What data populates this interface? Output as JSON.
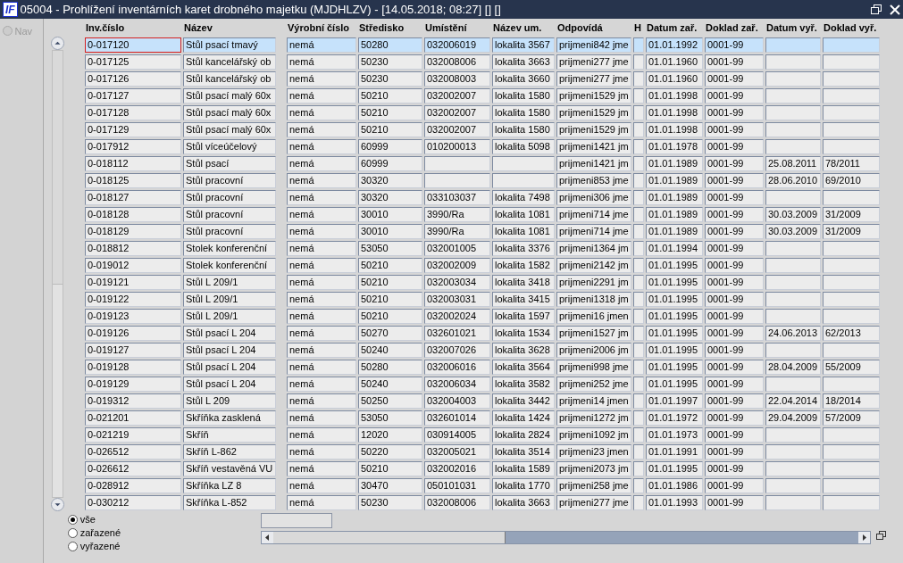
{
  "window": {
    "logo": "IF",
    "title": "05004 - Prohlížení inventárních karet drobného majetku (MJDHLZV) - [14.05.2018; 08:27]  []  []"
  },
  "nav": {
    "label": "Nav",
    "selected": false,
    "disabled": true
  },
  "table": {
    "columns": [
      "Inv.číslo",
      "Název",
      "Výrobní číslo",
      "Středisko",
      "Umístění",
      "Název um.",
      "Odpovídá",
      "H",
      "Datum zař.",
      "Doklad zař.",
      "Datum vyř.",
      "Doklad vyř."
    ],
    "rows": [
      {
        "selected": true,
        "cells": [
          "0-017120",
          "Stůl psací tmavý",
          "nemá",
          "50280",
          "032006019",
          "lokalita 3567",
          "prijmeni842 jme",
          null,
          "01.01.1992",
          "0001-99",
          null,
          null
        ]
      },
      {
        "selected": false,
        "cells": [
          "0-017125",
          "Stůl kancelářský ob",
          "nemá",
          "50230",
          "032008006",
          "lokalita 3663",
          "prijmeni277 jme",
          null,
          "01.01.1960",
          "0001-99",
          null,
          null
        ]
      },
      {
        "selected": false,
        "cells": [
          "0-017126",
          "Stůl kancelářský ob",
          "nemá",
          "50230",
          "032008003",
          "lokalita 3660",
          "prijmeni277 jme",
          null,
          "01.01.1960",
          "0001-99",
          null,
          null
        ]
      },
      {
        "selected": false,
        "cells": [
          "0-017127",
          "Stůl psací malý 60x",
          "nemá",
          "50210",
          "032002007",
          "lokalita 1580",
          "prijmeni1529 jm",
          null,
          "01.01.1998",
          "0001-99",
          null,
          null
        ]
      },
      {
        "selected": false,
        "cells": [
          "0-017128",
          "Stůl psací malý 60x",
          "nemá",
          "50210",
          "032002007",
          "lokalita 1580",
          "prijmeni1529 jm",
          null,
          "01.01.1998",
          "0001-99",
          null,
          null
        ]
      },
      {
        "selected": false,
        "cells": [
          "0-017129",
          "Stůl psací malý 60x",
          "nemá",
          "50210",
          "032002007",
          "lokalita 1580",
          "prijmeni1529 jm",
          null,
          "01.01.1998",
          "0001-99",
          null,
          null
        ]
      },
      {
        "selected": false,
        "cells": [
          "0-017912",
          "Stůl víceúčelový",
          "nemá",
          "60999",
          "010200013",
          "lokalita 5098",
          "prijmeni1421 jm",
          null,
          "01.01.1978",
          "0001-99",
          null,
          null
        ]
      },
      {
        "selected": false,
        "cells": [
          "0-018112",
          "Stůl psací",
          "nemá",
          "60999",
          null,
          null,
          "prijmeni1421 jm",
          null,
          "01.01.1989",
          "0001-99",
          "25.08.2011",
          "78/2011"
        ]
      },
      {
        "selected": false,
        "cells": [
          "0-018125",
          "Stůl pracovní",
          "nemá",
          "30320",
          null,
          null,
          "prijmeni853 jme",
          null,
          "01.01.1989",
          "0001-99",
          "28.06.2010",
          "69/2010"
        ]
      },
      {
        "selected": false,
        "cells": [
          "0-018127",
          "Stůl pracovní",
          "nemá",
          "30320",
          "033103037",
          "lokalita 7498",
          "prijmeni306 jme",
          null,
          "01.01.1989",
          "0001-99",
          null,
          null
        ]
      },
      {
        "selected": false,
        "cells": [
          "0-018128",
          "Stůl pracovní",
          "nemá",
          "30010",
          "3990/Ra",
          "lokalita 1081",
          "prijmeni714 jme",
          null,
          "01.01.1989",
          "0001-99",
          "30.03.2009",
          "31/2009"
        ]
      },
      {
        "selected": false,
        "cells": [
          "0-018129",
          "Stůl pracovní",
          "nemá",
          "30010",
          "3990/Ra",
          "lokalita 1081",
          "prijmeni714 jme",
          null,
          "01.01.1989",
          "0001-99",
          "30.03.2009",
          "31/2009"
        ]
      },
      {
        "selected": false,
        "cells": [
          "0-018812",
          "Stolek konferenční",
          "nemá",
          "53050",
          "032001005",
          "lokalita 3376",
          "prijmeni1364 jm",
          null,
          "01.01.1994",
          "0001-99",
          null,
          null
        ]
      },
      {
        "selected": false,
        "cells": [
          "0-019012",
          "Stolek konferenční",
          "nemá",
          "50210",
          "032002009",
          "lokalita 1582",
          "prijmeni2142 jm",
          null,
          "01.01.1995",
          "0001-99",
          null,
          null
        ]
      },
      {
        "selected": false,
        "cells": [
          "0-019121",
          "Stůl L 209/1",
          "nemá",
          "50210",
          "032003034",
          "lokalita 3418",
          "prijmeni2291 jm",
          null,
          "01.01.1995",
          "0001-99",
          null,
          null
        ]
      },
      {
        "selected": false,
        "cells": [
          "0-019122",
          "Stůl L 209/1",
          "nemá",
          "50210",
          "032003031",
          "lokalita 3415",
          "prijmeni1318 jm",
          null,
          "01.01.1995",
          "0001-99",
          null,
          null
        ]
      },
      {
        "selected": false,
        "cells": [
          "0-019123",
          "Stůl L 209/1",
          "nemá",
          "50210",
          "032002024",
          "lokalita 1597",
          "prijmeni16 jmen",
          null,
          "01.01.1995",
          "0001-99",
          null,
          null
        ]
      },
      {
        "selected": false,
        "cells": [
          "0-019126",
          "Stůl psací L 204",
          "nemá",
          "50270",
          "032601021",
          "lokalita 1534",
          "prijmeni1527 jm",
          null,
          "01.01.1995",
          "0001-99",
          "24.06.2013",
          "62/2013"
        ]
      },
      {
        "selected": false,
        "cells": [
          "0-019127",
          "Stůl psací L 204",
          "nemá",
          "50240",
          "032007026",
          "lokalita 3628",
          "prijmeni2006 jm",
          null,
          "01.01.1995",
          "0001-99",
          null,
          null
        ]
      },
      {
        "selected": false,
        "cells": [
          "0-019128",
          "Stůl psací L 204",
          "nemá",
          "50280",
          "032006016",
          "lokalita 3564",
          "prijmeni998 jme",
          null,
          "01.01.1995",
          "0001-99",
          "28.04.2009",
          "55/2009"
        ]
      },
      {
        "selected": false,
        "cells": [
          "0-019129",
          "Stůl psací L 204",
          "nemá",
          "50240",
          "032006034",
          "lokalita 3582",
          "prijmeni252 jme",
          null,
          "01.01.1995",
          "0001-99",
          null,
          null
        ]
      },
      {
        "selected": false,
        "cells": [
          "0-019312",
          "Stůl L 209",
          "nemá",
          "50250",
          "032004003",
          "lokalita 3442",
          "prijmeni14 jmen",
          null,
          "01.01.1997",
          "0001-99",
          "22.04.2014",
          "18/2014"
        ]
      },
      {
        "selected": false,
        "cells": [
          "0-021201",
          "Skříňka zasklená",
          "nemá",
          "53050",
          "032601014",
          "lokalita 1424",
          "prijmeni1272 jm",
          null,
          "01.01.1972",
          "0001-99",
          "29.04.2009",
          "57/2009"
        ]
      },
      {
        "selected": false,
        "cells": [
          "0-021219",
          "Skříň",
          "nemá",
          "12020",
          "030914005",
          "lokalita 2824",
          "prijmeni1092 jm",
          null,
          "01.01.1973",
          "0001-99",
          null,
          null
        ]
      },
      {
        "selected": false,
        "cells": [
          "0-026512",
          "Skříň L-862",
          "nemá",
          "50220",
          "032005021",
          "lokalita 3514",
          "prijmeni23 jmen",
          null,
          "01.01.1991",
          "0001-99",
          null,
          null
        ]
      },
      {
        "selected": false,
        "cells": [
          "0-026612",
          "Skříň vestavěná VU",
          "nemá",
          "50210",
          "032002016",
          "lokalita 1589",
          "prijmeni2073 jm",
          null,
          "01.01.1995",
          "0001-99",
          null,
          null
        ]
      },
      {
        "selected": false,
        "cells": [
          "0-028912",
          "Skříňka LZ 8",
          "nemá",
          "30470",
          "050101031",
          "lokalita 1770",
          "prijmeni258 jme",
          null,
          "01.01.1986",
          "0001-99",
          null,
          null
        ]
      },
      {
        "selected": false,
        "cells": [
          "0-030212",
          "Skříňka L-852",
          "nemá",
          "50230",
          "032008006",
          "lokalita 3663",
          "prijmeni277 jme",
          null,
          "01.01.1993",
          "0001-99",
          null,
          null
        ]
      }
    ]
  },
  "filter": [
    {
      "label": "vše",
      "selected": true
    },
    {
      "label": "zařazené",
      "selected": false
    },
    {
      "label": "vyřazené",
      "selected": false
    }
  ]
}
